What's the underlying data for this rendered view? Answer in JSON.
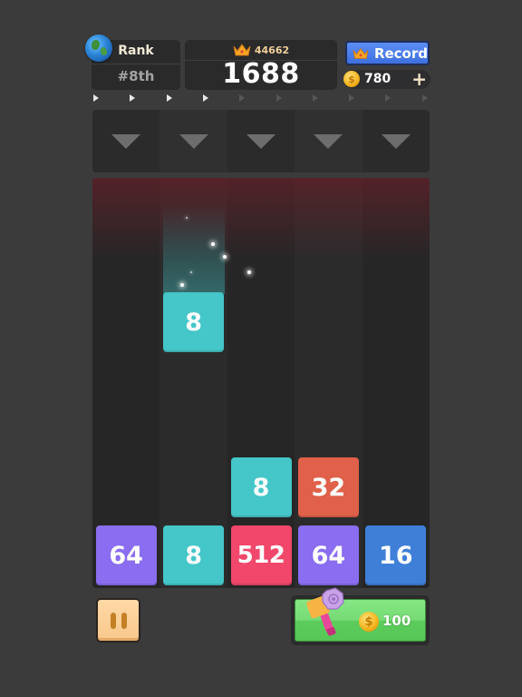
{
  "header": {
    "rank": {
      "label": "Rank",
      "value": "#8th",
      "icon": "globe-icon"
    },
    "score": {
      "best_label_icon": "crown-icon",
      "best": "44662",
      "current": "1688"
    },
    "record_button": {
      "label": "Record",
      "icon": "crown-icon",
      "color": "#4a7df0"
    },
    "coins": {
      "count": "780",
      "icon": "coin-icon",
      "coin_symbol": "$",
      "add_label": "+"
    }
  },
  "progress": {
    "total_steps": 10,
    "completed_steps": 4
  },
  "drop_row": {
    "columns": 5,
    "icon": "triangle-down-icon"
  },
  "board": {
    "columns": 5,
    "rows": 6,
    "falling_tile": {
      "value": "8",
      "column": 1,
      "row_from_top": 1.6,
      "color": "#45c6c8"
    },
    "tiles": [
      {
        "value": "8",
        "column": 2,
        "row_from_bottom": 1,
        "color": "#45c6c8"
      },
      {
        "value": "32",
        "column": 3,
        "row_from_bottom": 1,
        "color": "#e0604a"
      },
      {
        "value": "64",
        "column": 0,
        "row_from_bottom": 0,
        "color": "#8a6df0"
      },
      {
        "value": "8",
        "column": 1,
        "row_from_bottom": 0,
        "color": "#45c6c8"
      },
      {
        "value": "512",
        "column": 2,
        "row_from_bottom": 0,
        "color": "#f0476b"
      },
      {
        "value": "64",
        "column": 3,
        "row_from_bottom": 0,
        "color": "#8a6df0"
      },
      {
        "value": "16",
        "column": 4,
        "row_from_bottom": 0,
        "color": "#3f7fd8"
      }
    ]
  },
  "footer": {
    "pause_button": {
      "icon": "pause-icon",
      "color": "#f8c88c"
    },
    "hammer_button": {
      "icon": "hammer-icon",
      "price": "100",
      "currency_icon": "coin-icon",
      "coin_symbol": "$",
      "color": "#76db74"
    }
  }
}
